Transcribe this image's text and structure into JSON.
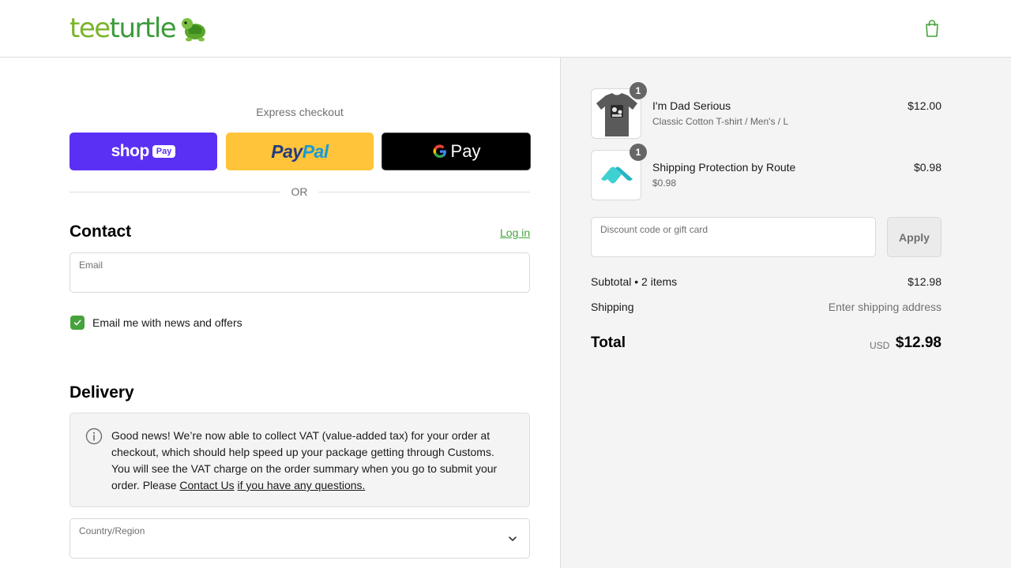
{
  "header": {
    "logo": {
      "part1": "tee",
      "part2": "turtle"
    },
    "cart_icon": "shopping-bag-icon"
  },
  "express": {
    "title": "Express checkout",
    "shop_pay": {
      "word": "shop",
      "badge": "Pay"
    },
    "paypal": {
      "part1": "Pay",
      "part2": "Pal"
    },
    "gpay": {
      "g": "G",
      "word": "Pay"
    },
    "or_label": "OR"
  },
  "contact": {
    "title": "Contact",
    "login_label": "Log in",
    "email": {
      "label": "Email",
      "value": ""
    },
    "newsletter": {
      "label": "Email me with news and offers",
      "checked": true
    }
  },
  "delivery": {
    "title": "Delivery",
    "notice": {
      "text": "Good news! We’re now able to collect VAT (value-added tax) for your order at checkout, which should help speed up your package getting through Customs. You will see the VAT charge on the order summary when you go to submit your order. Please ",
      "link1": "Contact Us",
      "link2": "if you have any questions."
    },
    "country": {
      "label": "Country/Region",
      "value": ""
    }
  },
  "summary": {
    "items": [
      {
        "name": "I'm Dad Serious",
        "variant": "Classic Cotton T-shirt / Men's / L",
        "price": "$12.00",
        "qty": "1"
      },
      {
        "name": "Shipping Protection by Route",
        "variant": "$0.98",
        "price": "$0.98",
        "qty": "1"
      }
    ],
    "discount": {
      "placeholder": "Discount code or gift card",
      "apply_label": "Apply"
    },
    "subtotal": {
      "label": "Subtotal • 2 items",
      "value": "$12.98"
    },
    "shipping": {
      "label": "Shipping",
      "value": "Enter shipping address"
    },
    "total": {
      "label": "Total",
      "currency": "USD",
      "value": "$12.98"
    }
  },
  "colors": {
    "brand_green": "#46a33c",
    "shop_pay": "#5a31f4",
    "paypal": "#ffc439",
    "gpay": "#000000"
  }
}
